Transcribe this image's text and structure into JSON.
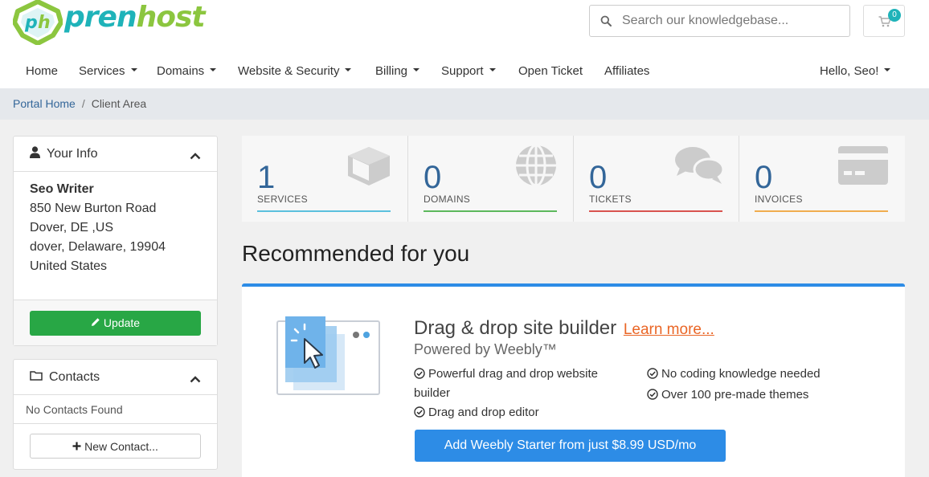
{
  "brand": {
    "logo_badge": "ph",
    "name_part1": "pren",
    "name_part2": "host"
  },
  "search": {
    "placeholder": "Search our knowledgebase..."
  },
  "cart": {
    "count": "0"
  },
  "nav": {
    "items": [
      {
        "label": "Home",
        "dropdown": false
      },
      {
        "label": "Services",
        "dropdown": true
      },
      {
        "label": "Domains",
        "dropdown": true
      },
      {
        "label": "Website & Security",
        "dropdown": true
      },
      {
        "label": "Billing",
        "dropdown": true
      },
      {
        "label": "Support",
        "dropdown": true
      },
      {
        "label": "Open Ticket",
        "dropdown": false
      },
      {
        "label": "Affiliates",
        "dropdown": false
      }
    ],
    "user_greeting": "Hello, Seo!"
  },
  "breadcrumb": {
    "home": "Portal Home",
    "separator": "/",
    "current": "Client Area"
  },
  "your_info": {
    "title": "Your Info",
    "name": "Seo Writer",
    "address_line1": "850 New Burton Road",
    "address_line2": "Dover, DE ,US",
    "address_line3": "dover, Delaware, 19904",
    "country": "United States",
    "update_label": "Update"
  },
  "contacts": {
    "title": "Contacts",
    "empty_text": "No Contacts Found",
    "new_label": "New Contact..."
  },
  "stats": [
    {
      "count": "1",
      "label": "SERVICES",
      "color": "#5bc0de",
      "icon": "cube-icon"
    },
    {
      "count": "0",
      "label": "DOMAINS",
      "color": "#5cb85c",
      "icon": "globe-icon"
    },
    {
      "count": "0",
      "label": "TICKETS",
      "color": "#d9534f",
      "icon": "comments-icon"
    },
    {
      "count": "0",
      "label": "INVOICES",
      "color": "#f0ad4e",
      "icon": "credit-card-icon"
    }
  ],
  "recommended": {
    "title": "Recommended for you",
    "product_title": "Drag & drop site builder",
    "learn_more": "Learn more...",
    "powered_by": "Powered by Weebly™",
    "features": [
      "Powerful drag and drop website builder",
      "Drag and drop editor",
      "No coding knowledge needed",
      "Over 100 pre-made themes"
    ],
    "cta": "Add Weebly Starter from just $8.99 USD/mo"
  },
  "colors": {
    "accent": "#2d8ce6",
    "brand_teal": "#1fb3b9",
    "brand_green": "#8cc63f",
    "success": "#28a745",
    "link": "#336699",
    "learn_more": "#ea6626"
  }
}
